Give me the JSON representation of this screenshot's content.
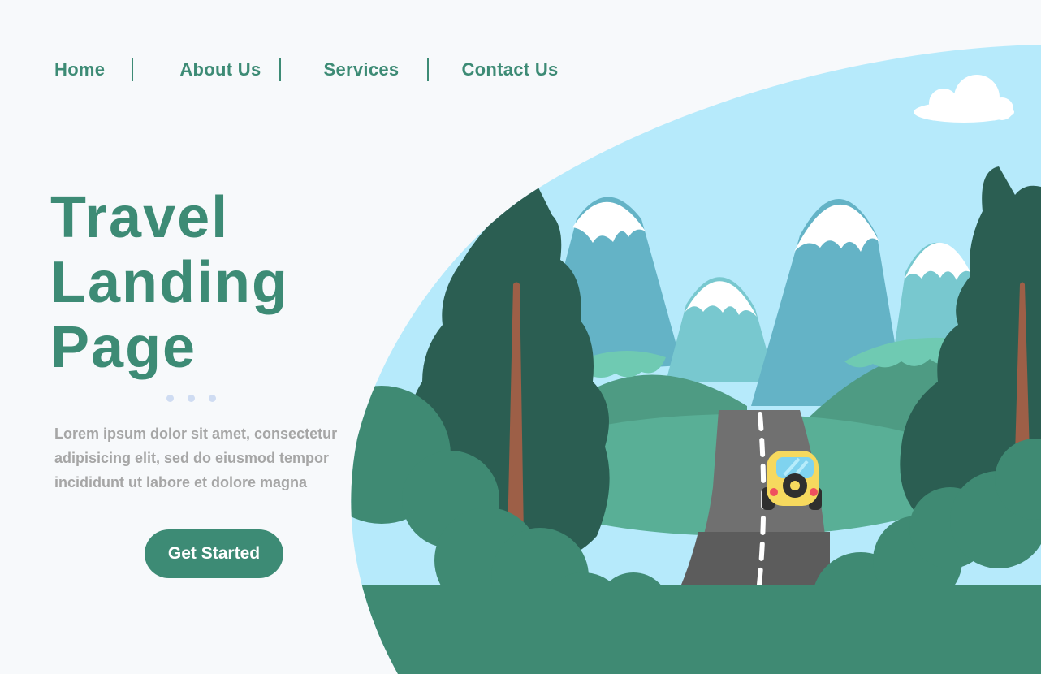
{
  "nav": {
    "items": [
      {
        "label": "Home"
      },
      {
        "label": "About Us"
      },
      {
        "label": "Services"
      },
      {
        "label": "Contact Us"
      }
    ],
    "separator": "|"
  },
  "hero": {
    "title_lines": [
      "Travel",
      "Landing",
      "Page"
    ],
    "description_lines": [
      "Lorem ipsum dolor sit amet, consectetur",
      "adipisicing elit, sed do eiusmod tempor",
      "incididunt ut labore et dolore magna"
    ],
    "cta_label": "Get Started"
  },
  "colors": {
    "brand": "#3d8b75",
    "sky": "#b6eafb",
    "background": "#f7f9fb",
    "dark_tree": "#2b5e52",
    "bush": "#3f8a73",
    "mountain": "#64b3c6",
    "hills": "#59af96",
    "road": "#707070",
    "car": "#f6d95e"
  }
}
